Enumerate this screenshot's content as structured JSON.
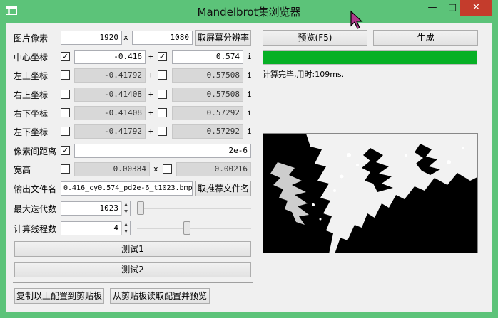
{
  "window": {
    "title": "Mandelbrot集浏览器",
    "minimize_glyph": "—",
    "maximize_glyph": "□",
    "close_glyph": "✕"
  },
  "form": {
    "pixels": {
      "label": "图片像素",
      "width": "1920",
      "sep": "x",
      "height": "1080",
      "button": "取屏幕分辨率"
    },
    "center": {
      "label": "中心坐标",
      "checked": true,
      "re": "-0.416",
      "plus": "+",
      "im_checked": true,
      "im": "0.574",
      "i": "i"
    },
    "top_left": {
      "label": "左上坐标",
      "re": "-0.41792",
      "plus": "+",
      "im": "0.57508",
      "i": "i"
    },
    "top_right": {
      "label": "右上坐标",
      "re": "-0.41408",
      "plus": "+",
      "im": "0.57508",
      "i": "i"
    },
    "bottom_right": {
      "label": "右下坐标",
      "re": "-0.41408",
      "plus": "+",
      "im": "0.57292",
      "i": "i"
    },
    "bottom_left": {
      "label": "左下坐标",
      "re": "-0.41792",
      "plus": "+",
      "im": "0.57292",
      "i": "i"
    },
    "pixel_distance": {
      "label": "像素间距离",
      "checked": true,
      "value": "2e-6"
    },
    "size": {
      "label": "宽高",
      "width": "0.00384",
      "sep": "x",
      "height": "0.00216"
    },
    "output_file": {
      "label": "输出文件名",
      "value": "0.416_cy0.574_pd2e-6_t1023.bmp",
      "button": "取推荐文件名"
    },
    "max_iter": {
      "label": "最大迭代数",
      "value": "1023",
      "slider_level": 0.0
    },
    "threads": {
      "label": "计算线程数",
      "value": "4",
      "slider_level": 0.43
    },
    "test1": "测试1",
    "test2": "测试2",
    "copy_config": "复制以上配置到剪贴板",
    "paste_config": "从剪贴板读取配置并预览"
  },
  "right": {
    "preview_button": "预览(F5)",
    "generate_button": "生成",
    "progress": 1.0,
    "status": "计算完毕,用时:109ms."
  },
  "colors": {
    "accent": "#5cc379",
    "progress": "#06b025",
    "close": "#c43c2c"
  }
}
